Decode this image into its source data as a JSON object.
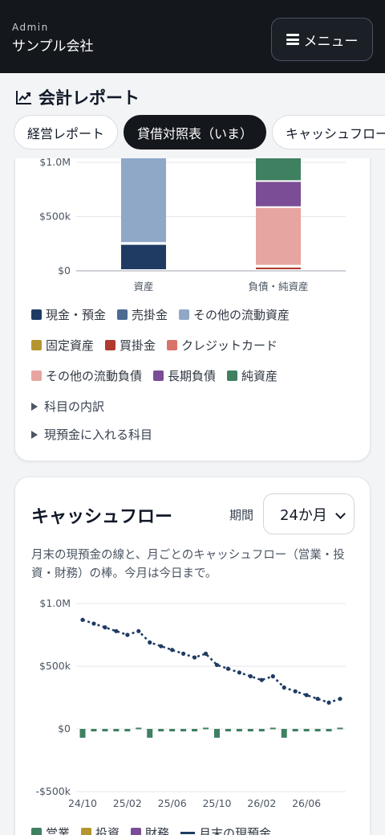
{
  "topbar": {
    "admin_label": "Admin",
    "company_name": "サンプル会社",
    "menu_label": "メニュー"
  },
  "report": {
    "title": "会計レポート",
    "title_icon": "chart-up-icon",
    "tabs": [
      {
        "label": "経営レポート",
        "active": false
      },
      {
        "label": "貸借対照表（いま）",
        "active": true
      },
      {
        "label": "キャッシュフロー",
        "active": false
      }
    ]
  },
  "balance_sheet": {
    "legend": [
      {
        "label": "現金・預金",
        "color": "#1f3b63"
      },
      {
        "label": "売掛金",
        "color": "#4c6a92"
      },
      {
        "label": "その他の流動資産",
        "color": "#8fa8c8"
      },
      {
        "label": "固定資産",
        "color": "#b5952f"
      },
      {
        "label": "買掛金",
        "color": "#b03a2e"
      },
      {
        "label": "クレジットカード",
        "color": "#d9736a"
      },
      {
        "label": "その他の流動負債",
        "color": "#e6a5a0"
      },
      {
        "label": "長期負債",
        "color": "#7b4d96"
      },
      {
        "label": "純資産",
        "color": "#3f8060"
      }
    ],
    "details_1": "科目の内訳",
    "details_2": "現預金に入れる科目"
  },
  "cashflow": {
    "title": "キャッシュフロー",
    "period_label": "期間",
    "period_value": "24か月",
    "description": "月末の現預金の線と、月ごとのキャッシュフロー（営業・投資・財務）の棒。今月は今日まで。",
    "legend": [
      {
        "label": "営業",
        "color": "#3f8060"
      },
      {
        "label": "投資",
        "color": "#b5952f"
      },
      {
        "label": "財務",
        "color": "#7b4d96"
      },
      {
        "label": "月末の現預金",
        "color": "#1f3b63"
      }
    ]
  },
  "chart_data": [
    {
      "type": "bar",
      "stacked": true,
      "categories": [
        "資産",
        "負債・純資産"
      ],
      "y_tick_labels": [
        "$0",
        "$500k",
        "$1.0M"
      ],
      "ylim": [
        0,
        1000000
      ],
      "series": [
        {
          "name": "現金・預金",
          "values": [
            240000,
            0
          ]
        },
        {
          "name": "売掛金",
          "values": [
            10000,
            0
          ]
        },
        {
          "name": "その他の流動資産",
          "values": [
            1000000,
            0
          ]
        },
        {
          "name": "固定資産",
          "values": [
            0,
            0
          ]
        },
        {
          "name": "買掛金",
          "values": [
            0,
            30000
          ]
        },
        {
          "name": "クレジットカード",
          "values": [
            0,
            10000
          ]
        },
        {
          "name": "その他の流動負債",
          "values": [
            0,
            540000
          ]
        },
        {
          "name": "長期負債",
          "values": [
            0,
            240000
          ]
        },
        {
          "name": "純資産",
          "values": [
            0,
            440000
          ]
        }
      ],
      "grid": true,
      "legend_position": "bottom"
    },
    {
      "type": "line",
      "x": [
        "24/10",
        "24/11",
        "24/12",
        "25/01",
        "25/02",
        "25/03",
        "25/04",
        "25/05",
        "25/06",
        "25/07",
        "25/08",
        "25/09",
        "25/10",
        "25/11",
        "25/12",
        "26/01",
        "26/02",
        "26/03",
        "26/04",
        "26/05",
        "26/06",
        "26/07",
        "26/08",
        "26/09"
      ],
      "x_tick_labels": [
        "24/10",
        "25/02",
        "25/06",
        "25/10",
        "26/02",
        "26/06"
      ],
      "y_tick_labels": [
        "-$500k",
        "$0",
        "$500k",
        "$1.0M"
      ],
      "ylim": [
        -500000,
        1000000
      ],
      "series": [
        {
          "name": "月末の現預金",
          "kind": "line",
          "values": [
            870000,
            840000,
            810000,
            780000,
            750000,
            780000,
            690000,
            660000,
            630000,
            600000,
            570000,
            600000,
            510000,
            480000,
            450000,
            420000,
            390000,
            420000,
            330000,
            300000,
            270000,
            240000,
            210000,
            240000
          ]
        },
        {
          "name": "営業",
          "kind": "bar",
          "values": [
            -70000,
            -20000,
            -20000,
            -20000,
            -20000,
            10000,
            -70000,
            -20000,
            -20000,
            -20000,
            -20000,
            10000,
            -70000,
            -20000,
            -20000,
            -20000,
            -20000,
            10000,
            -70000,
            -20000,
            -20000,
            -20000,
            -20000,
            10000
          ]
        },
        {
          "name": "投資",
          "kind": "bar",
          "values": [
            0,
            0,
            0,
            0,
            0,
            0,
            0,
            0,
            0,
            0,
            0,
            0,
            0,
            0,
            0,
            0,
            0,
            0,
            0,
            0,
            0,
            0,
            0,
            0
          ]
        },
        {
          "name": "財務",
          "kind": "bar",
          "values": [
            0,
            0,
            0,
            0,
            0,
            0,
            0,
            0,
            0,
            0,
            0,
            0,
            0,
            0,
            0,
            0,
            0,
            0,
            0,
            0,
            0,
            0,
            0,
            0
          ]
        }
      ],
      "grid": true,
      "legend_position": "bottom"
    }
  ]
}
